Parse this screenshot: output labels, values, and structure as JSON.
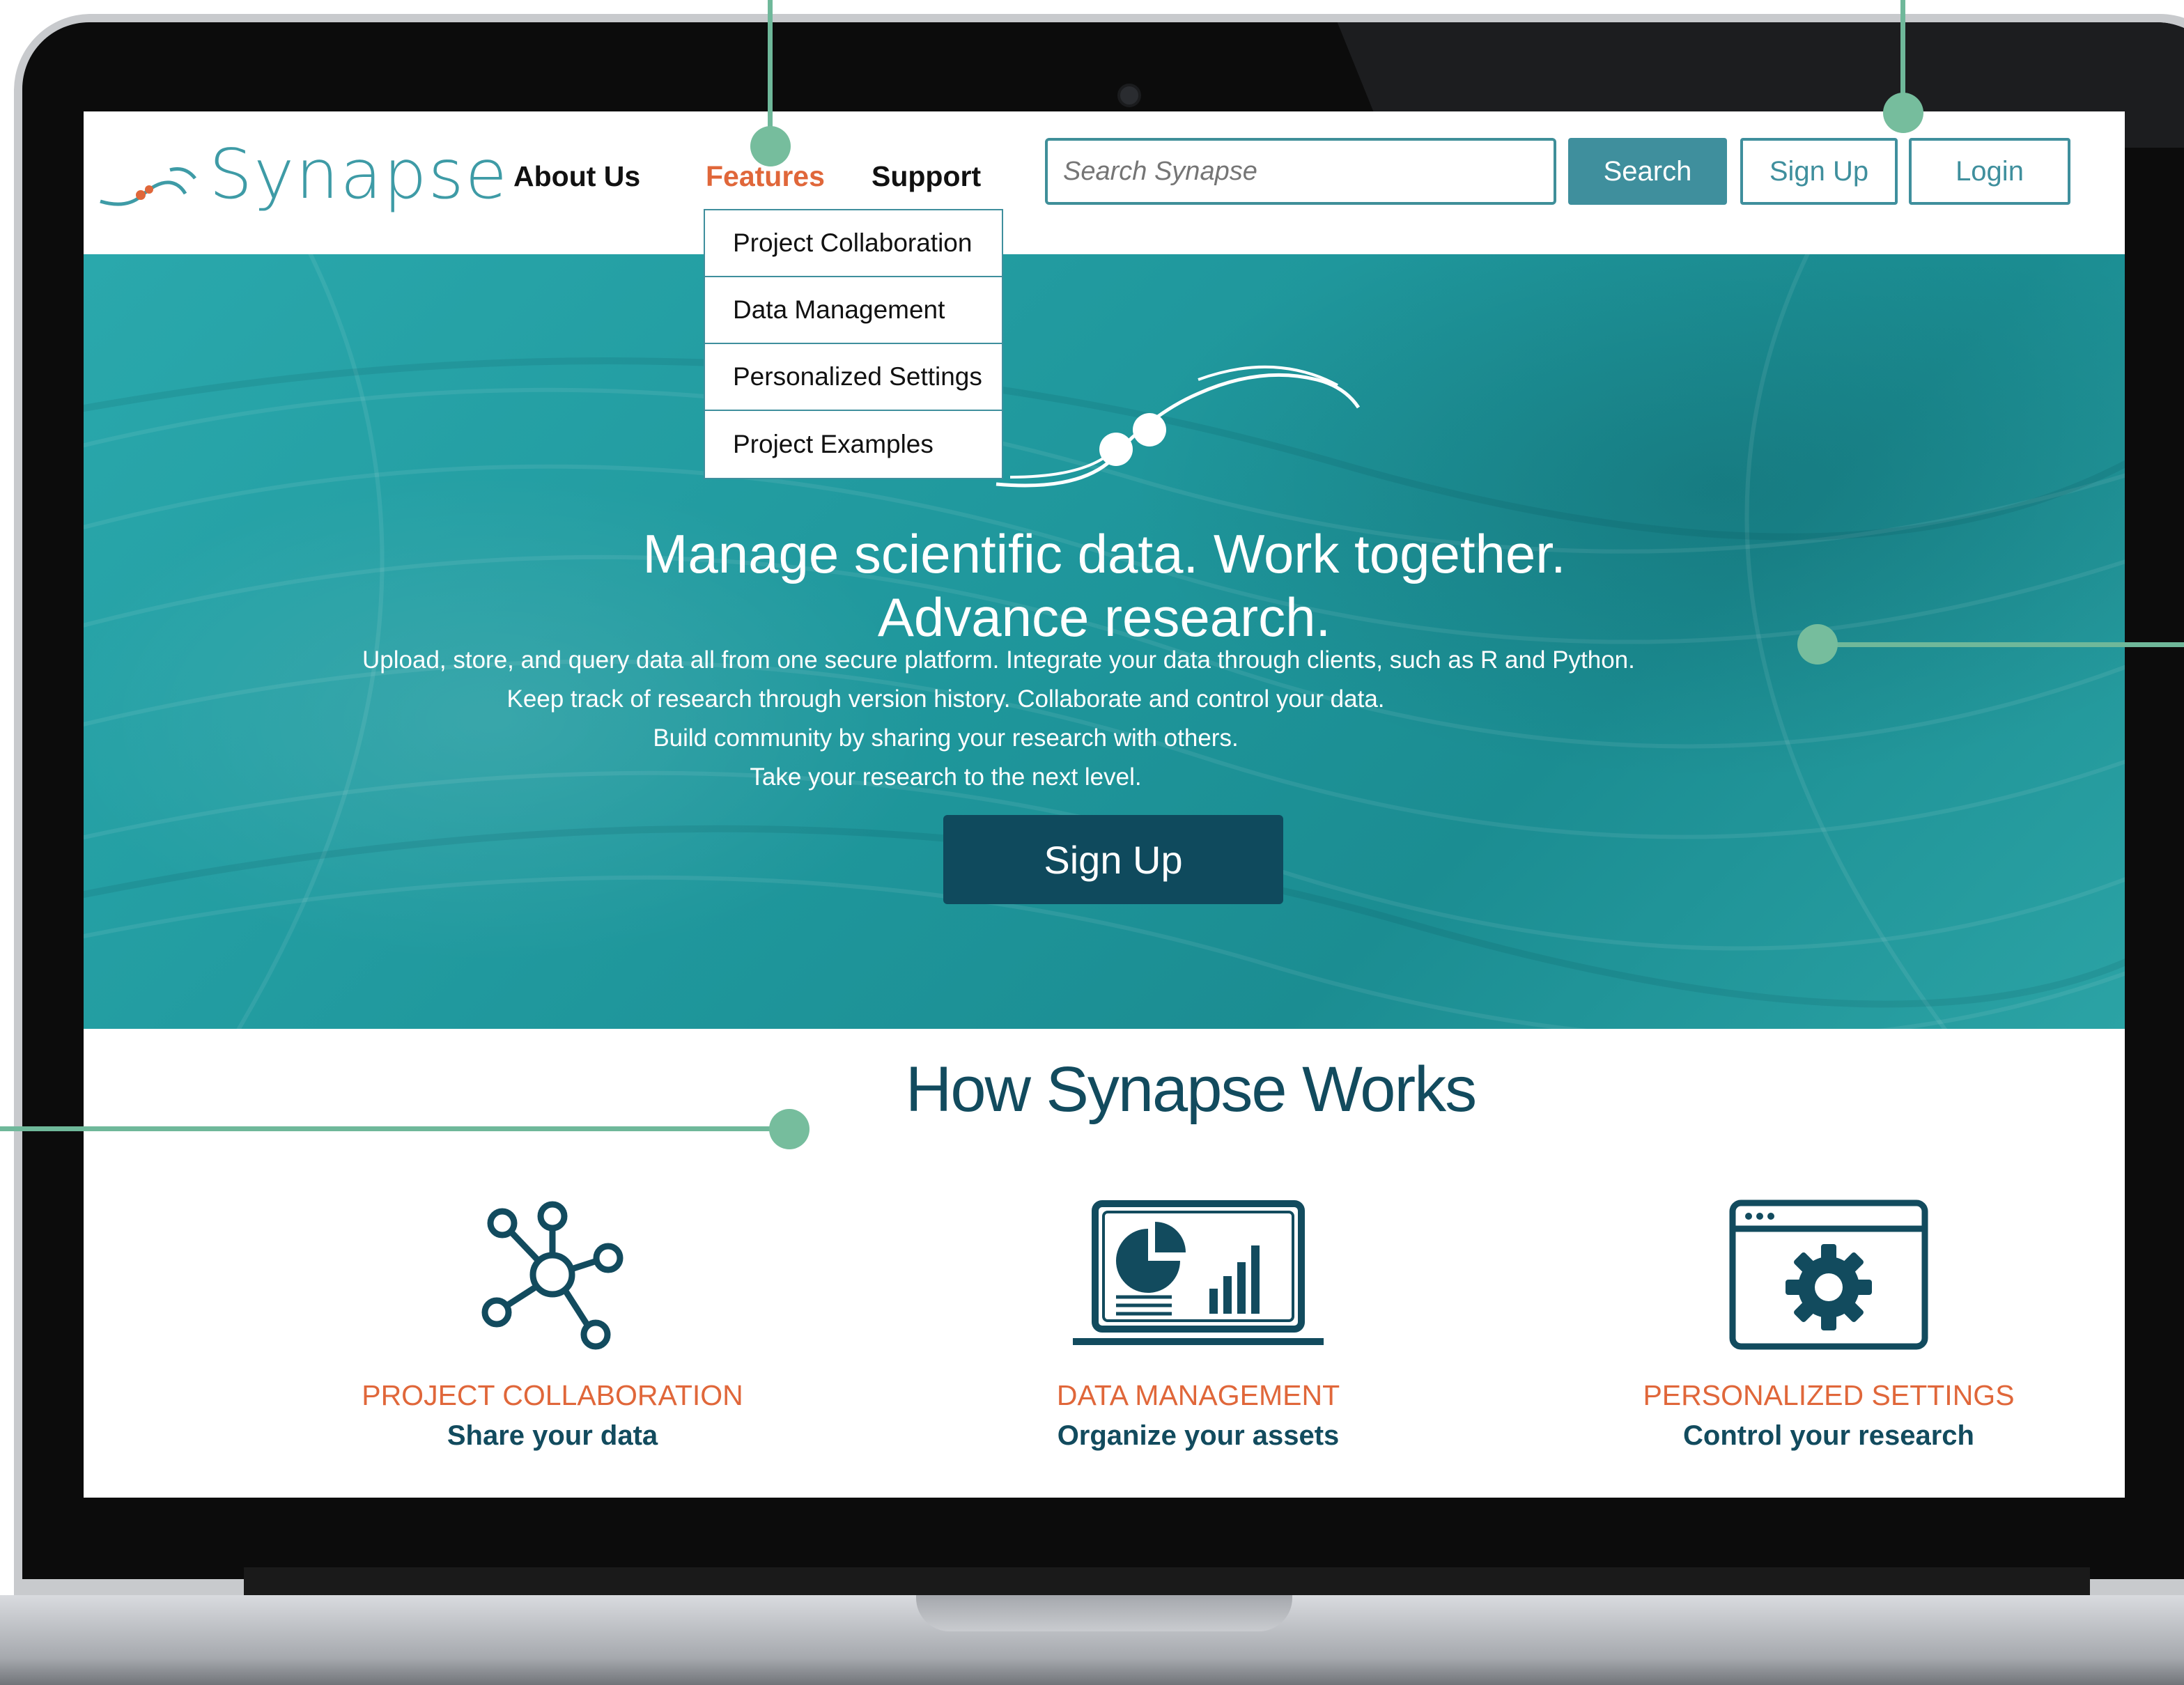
{
  "brand": {
    "name": "Synapse"
  },
  "nav": {
    "links": [
      "About Us",
      "Features",
      "Support"
    ],
    "active": "Features"
  },
  "search": {
    "placeholder": "Search Synapse",
    "button": "Search"
  },
  "auth": {
    "signup": "Sign Up",
    "login": "Login"
  },
  "features_menu": {
    "items": [
      "Project Collaboration",
      "Data Management",
      "Personalized Settings",
      "Project Examples"
    ]
  },
  "hero": {
    "headline": "Manage scientific data. Work together.  Advance research.",
    "lines": [
      "Upload, store, and query data all from one secure platform. Integrate your data through clients, such as R and Python.",
      "Keep track of research through version history.  Collaborate and control your data.",
      "Build community by sharing your research with others.",
      "Take your research to the next level."
    ],
    "cta": "Sign Up"
  },
  "how": {
    "title": "How Synapse Works",
    "features": [
      {
        "title": "PROJECT COLLABORATION",
        "subtitle": "Share your data",
        "icon": "network-icon"
      },
      {
        "title": "DATA MANAGEMENT",
        "subtitle": "Organize your assets",
        "icon": "analytics-laptop-icon"
      },
      {
        "title": "PERSONALIZED SETTINGS",
        "subtitle": "Control your research",
        "icon": "settings-window-icon"
      }
    ]
  },
  "colors": {
    "brand_teal": "#3e9ba6",
    "accent_orange": "#e0673a",
    "dark_navy": "#124b5e",
    "callout_green": "#76bd9d",
    "hero_teal": "#1f979c"
  }
}
